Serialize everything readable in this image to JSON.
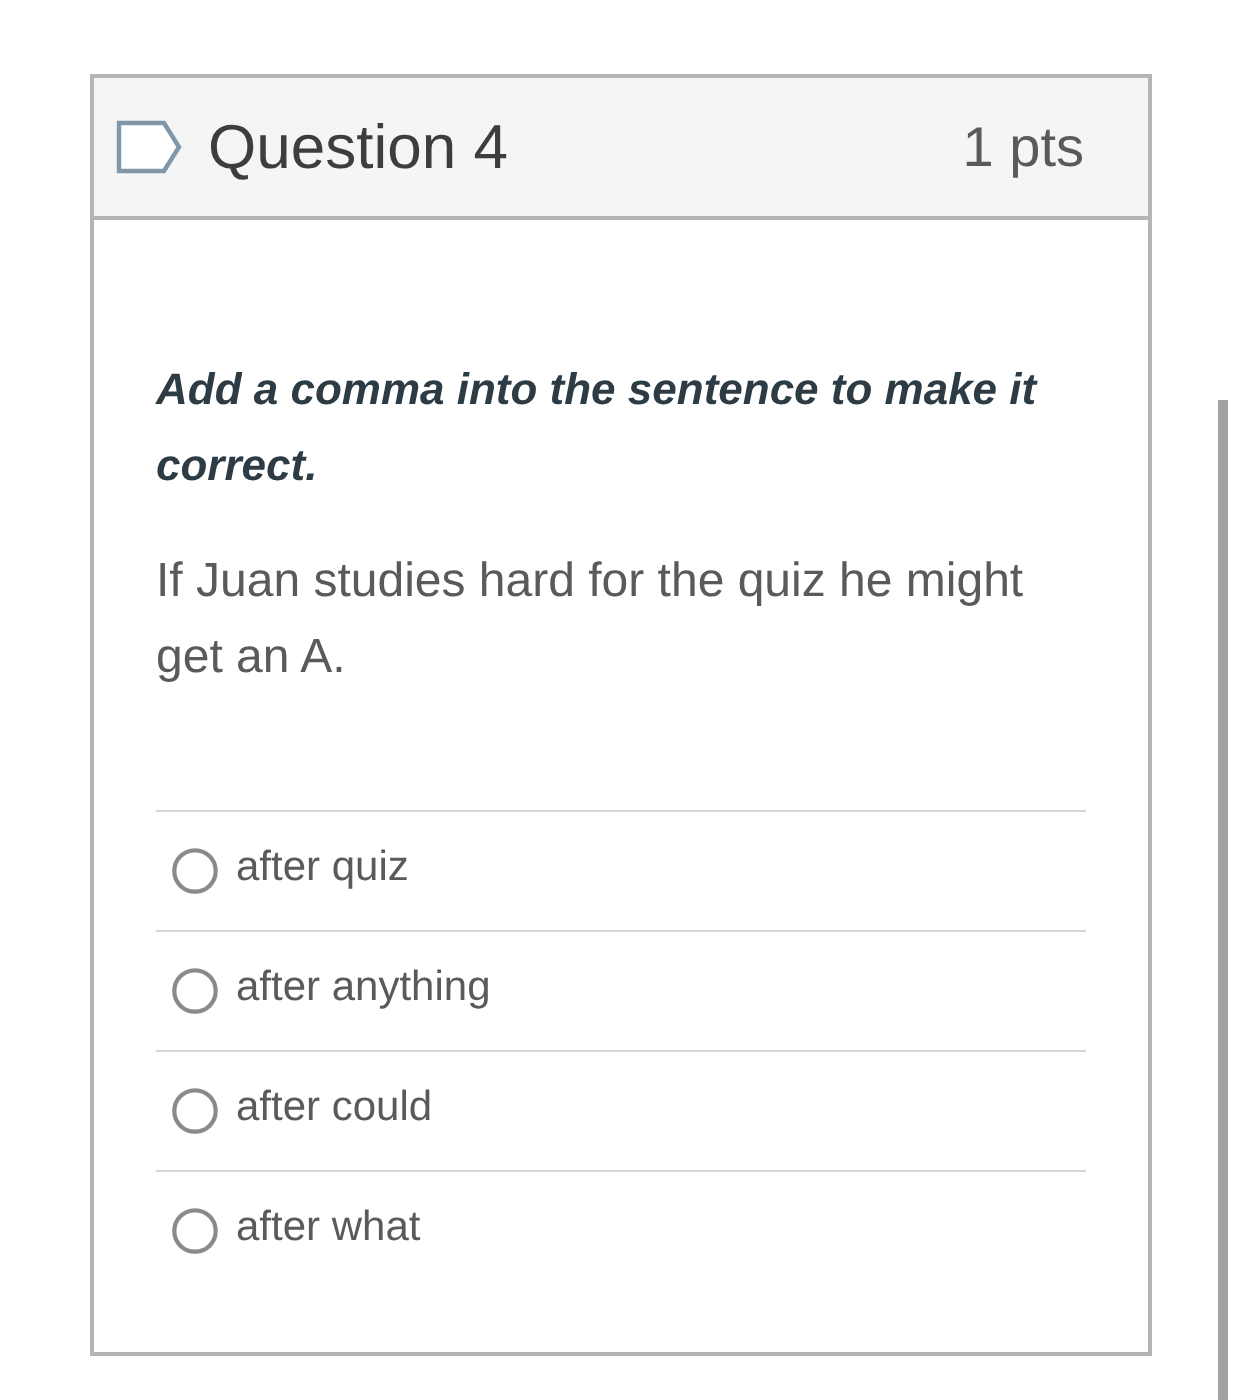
{
  "question": {
    "title": "Question 4",
    "points": "1 pts"
  },
  "prompt": "Add a comma into the sentence to make it correct.",
  "sentence": "If Juan studies hard for the quiz he might get an A.",
  "answers": [
    {
      "label": "after quiz",
      "selected": false
    },
    {
      "label": "after anything",
      "selected": false
    },
    {
      "label": "after could",
      "selected": false
    },
    {
      "label": "after what",
      "selected": false
    }
  ]
}
